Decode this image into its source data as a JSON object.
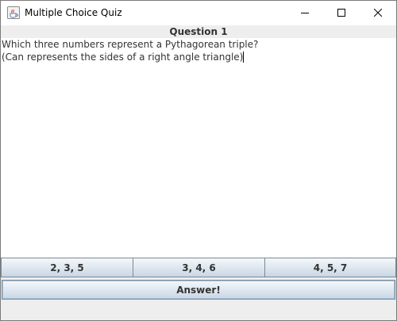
{
  "window": {
    "title": "Multiple Choice Quiz",
    "icon": "java-cup-icon",
    "controls": [
      "minimize-icon",
      "maximize-icon",
      "close-icon"
    ]
  },
  "quiz": {
    "header": "Question 1",
    "question_line_1": "Which three numbers represent a Pythagorean triple?",
    "question_line_2": "(Can represents the sides of a right angle triangle)",
    "choices": [
      "2, 3, 5",
      "3, 4, 6",
      "4, 5, 7"
    ],
    "answer_label": "Answer!"
  },
  "colors": {
    "title_bar": "#ffffff",
    "panel_background": "#eeeeee",
    "button_border": "#7a8a99",
    "text": "#333333"
  }
}
